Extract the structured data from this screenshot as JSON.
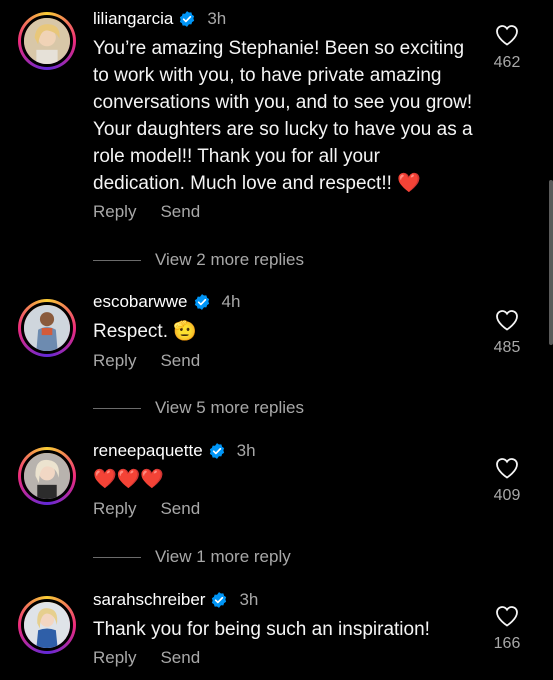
{
  "comments": [
    {
      "username": "liliangarcia",
      "time": "3h",
      "text": "You’re amazing Stephanie! Been so exciting to work with you, to have private amazing conversations with you, and to see you grow! Your daughters are so lucky to have you as a role model!! Thank you for all your dedication. Much love and respect!! ❤️",
      "likes": "462",
      "reply_label": "Reply",
      "send_label": "Send",
      "more_replies": "View 2 more replies"
    },
    {
      "username": "escobarwwe",
      "time": "4h",
      "text": "Respect. 🫡",
      "likes": "485",
      "reply_label": "Reply",
      "send_label": "Send",
      "more_replies": "View 5 more replies"
    },
    {
      "username": "reneepaquette",
      "time": "3h",
      "text": "❤️❤️❤️",
      "likes": "409",
      "reply_label": "Reply",
      "send_label": "Send",
      "more_replies": "View 1 more reply"
    },
    {
      "username": "sarahschreiber",
      "time": "3h",
      "text": "Thank you for being such an inspiration!",
      "likes": "166",
      "reply_label": "Reply",
      "send_label": "Send"
    }
  ],
  "colors": {
    "background": "#000000",
    "verified": "#0095f6",
    "secondary_text": "#a8a8a8",
    "heart": "#ee2a45"
  },
  "icons": [
    "heart-outline-icon",
    "verified-badge-icon"
  ]
}
